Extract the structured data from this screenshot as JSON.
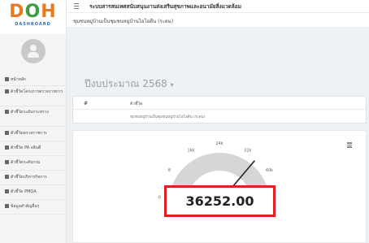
{
  "logo": {
    "text_d": "D",
    "text_o": "O",
    "text_h": "H",
    "sub": "DASHBOARD"
  },
  "topbar": {
    "title": "ระบบสารสนเทศสนับสนุนงานส่งเสริมสุขภาพและอนามัยสิ่งแวดล้อม"
  },
  "subbar": {
    "unit": "ชุมชนหมู่บ้านเป็นชุมชนหมู่บ้านไอโอดีน (ระดม)"
  },
  "sidebar": {
    "items": [
      {
        "label": "หน้าหลัก",
        "icon": "home-icon"
      },
      {
        "label": "ตัวชี้วัดโครงการตรวจราชการ",
        "icon": "chart-icon"
      },
      {
        "label": "ตัวชี้วัดระดับกระทรวง",
        "icon": "list-icon"
      },
      {
        "label": "ตัวชี้วัดตรวจราชการ",
        "icon": "list-icon"
      },
      {
        "label": "ตัวชี้วัด PA อธิบดี",
        "icon": "list-icon"
      },
      {
        "label": "ตัวชี้วัดระดับกรม",
        "icon": "list-icon"
      },
      {
        "label": "ตัวชี้วัดบริหารกิจการ",
        "icon": "list-icon"
      },
      {
        "label": "ตัวชี้วัด PMQA",
        "icon": "list-icon"
      },
      {
        "label": "ข้อมูลสำคัญอื่นๆ",
        "icon": "list-icon"
      }
    ]
  },
  "main": {
    "year_label": "ปีงบประมาณ 2568",
    "year_caret": "▾",
    "table": {
      "hash": "#",
      "column": "ตัวชี้วัด",
      "row": "ชุมชนหมู่บ้านเป็นชุมชนหมู่บ้านไอโอดีน (ระดม)"
    }
  },
  "chart_data": {
    "type": "gauge",
    "value": 36252.0,
    "value_label": "36252.00",
    "min": 0,
    "ticks": [
      "0",
      "8",
      "16k",
      "24k",
      "32k",
      "40k"
    ],
    "colors": {
      "track": "#d6d6d6",
      "highlight": "#e02020",
      "needle": "#222222"
    }
  }
}
